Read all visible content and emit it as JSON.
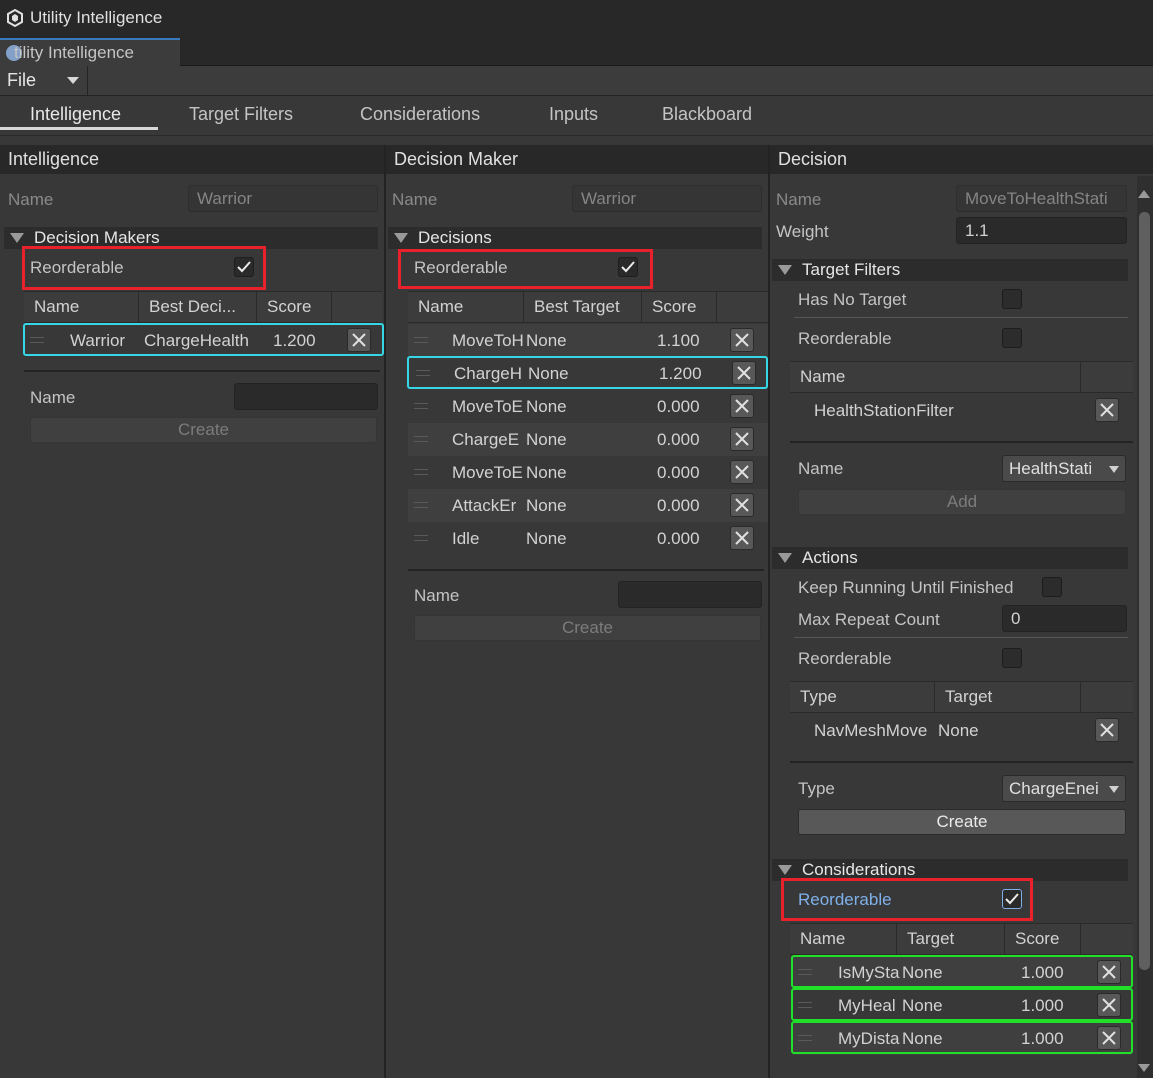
{
  "window": {
    "title": "Utility Intelligence",
    "doc_tab": "tility Intelligence"
  },
  "menu": {
    "file": "File"
  },
  "tabs": [
    {
      "label": "Intelligence",
      "active": true
    },
    {
      "label": "Target Filters",
      "active": false
    },
    {
      "label": "Considerations",
      "active": false
    },
    {
      "label": "Inputs",
      "active": false
    },
    {
      "label": "Blackboard",
      "active": false
    }
  ],
  "intelligence": {
    "header": "Intelligence",
    "name_label": "Name",
    "name_value": "Warrior",
    "decision_makers_label": "Decision Makers",
    "reorderable_label": "Reorderable",
    "reorderable": true,
    "columns": [
      "Name",
      "Best Deci...",
      "Score"
    ],
    "rows": [
      {
        "name": "Warrior",
        "best": "ChargeHealth",
        "score": "1.200"
      }
    ],
    "new_name_label": "Name",
    "new_name_value": "",
    "create_label": "Create"
  },
  "decision_maker": {
    "header": "Decision Maker",
    "name_label": "Name",
    "name_value": "Warrior",
    "decisions_label": "Decisions",
    "reorderable_label": "Reorderable",
    "reorderable": true,
    "columns": [
      "Name",
      "Best Target",
      "Score"
    ],
    "rows": [
      {
        "name": "MoveToH",
        "target": "None",
        "score": "1.100"
      },
      {
        "name": "ChargeH",
        "target": "None",
        "score": "1.200"
      },
      {
        "name": "MoveToE",
        "target": "None",
        "score": "0.000"
      },
      {
        "name": "ChargeE",
        "target": "None",
        "score": "0.000"
      },
      {
        "name": "MoveToE",
        "target": "None",
        "score": "0.000"
      },
      {
        "name": "AttackEr",
        "target": "None",
        "score": "0.000"
      },
      {
        "name": "Idle",
        "target": "None",
        "score": "0.000"
      }
    ],
    "new_name_label": "Name",
    "new_name_value": "",
    "create_label": "Create"
  },
  "decision": {
    "header": "Decision",
    "name_label": "Name",
    "name_value": "MoveToHealthStati",
    "weight_label": "Weight",
    "weight_value": "1.1",
    "target_filters_label": "Target Filters",
    "has_no_target_label": "Has No Target",
    "has_no_target": false,
    "tf_reorderable_label": "Reorderable",
    "tf_reorderable": false,
    "tf_columns": [
      "Name"
    ],
    "tf_rows": [
      {
        "name": "HealthStationFilter"
      }
    ],
    "tf_add_name_label": "Name",
    "tf_add_dropdown": "HealthStati",
    "tf_add_label": "Add",
    "actions_label": "Actions",
    "keep_running_label": "Keep Running Until Finished",
    "keep_running": false,
    "max_repeat_label": "Max Repeat Count",
    "max_repeat_value": "0",
    "act_reorderable_label": "Reorderable",
    "act_reorderable": false,
    "act_columns": [
      "Type",
      "Target"
    ],
    "act_rows": [
      {
        "type": "NavMeshMove",
        "target": "None"
      }
    ],
    "act_type_label": "Type",
    "act_type_dropdown": "ChargeEnei",
    "act_create_label": "Create",
    "considerations_label": "Considerations",
    "cons_reorderable_label": "Reorderable",
    "cons_reorderable": true,
    "cons_columns": [
      "Name",
      "Target",
      "Score"
    ],
    "cons_rows": [
      {
        "name": "IsMySta",
        "target": "None",
        "score": "1.000"
      },
      {
        "name": "MyHeal",
        "target": "None",
        "score": "1.000"
      },
      {
        "name": "MyDista",
        "target": "None",
        "score": "1.000"
      }
    ]
  }
}
